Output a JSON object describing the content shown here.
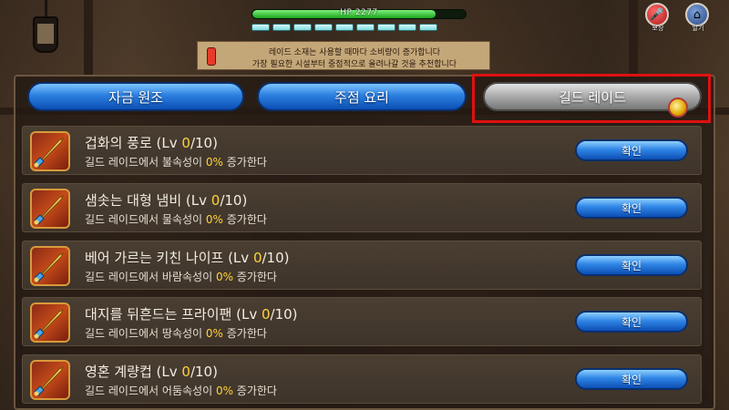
{
  "hud": {
    "hp_text": "HP 2277",
    "hp_fraction": 0.86,
    "energy_pips": 9,
    "icons": [
      {
        "name": "event-icon",
        "label": "보상"
      },
      {
        "name": "home-icon",
        "label": "알기"
      }
    ]
  },
  "notice": {
    "line1": "레이드 소재는 사용할 때마다 소비량이 증가합니다",
    "line2": "가장 필요한 시설부터 중점적으로 올려나갈 것을 추천합니다"
  },
  "tabs": [
    {
      "label": "자금 원조",
      "style": "blue"
    },
    {
      "label": "주점 요리",
      "style": "blue"
    },
    {
      "label": "길드 레이드",
      "style": "gray",
      "selected": true
    }
  ],
  "rows": [
    {
      "name": "겁화의 풍로",
      "lv_prefix": " (Lv ",
      "lv_cur": "0",
      "lv_max": "/10)",
      "desc_pre": "길드 레이드에서 불속성이 ",
      "pct": "0%",
      "desc_post": " 증가한다",
      "button": "확인"
    },
    {
      "name": "샘솟는 대형 냄비",
      "lv_prefix": " (Lv ",
      "lv_cur": "0",
      "lv_max": "/10)",
      "desc_pre": "길드 레이드에서 물속성이 ",
      "pct": "0%",
      "desc_post": " 증가한다",
      "button": "확인"
    },
    {
      "name": "베어 가르는 키친 나이프",
      "lv_prefix": " (Lv ",
      "lv_cur": "0",
      "lv_max": "/10)",
      "desc_pre": "길드 레이드에서 바람속성이 ",
      "pct": "0%",
      "desc_post": " 증가한다",
      "button": "확인"
    },
    {
      "name": "대지를 뒤흔드는 프라이팬",
      "lv_prefix": " (Lv ",
      "lv_cur": "0",
      "lv_max": "/10)",
      "desc_pre": "길드 레이드에서 땅속성이 ",
      "pct": "0%",
      "desc_post": " 증가한다",
      "button": "확인"
    },
    {
      "name": "영혼 계량컵",
      "lv_prefix": " (Lv ",
      "lv_cur": "0",
      "lv_max": "/10)",
      "desc_pre": "길드 레이드에서 어둠속성이 ",
      "pct": "0%",
      "desc_post": " 증가한다",
      "button": "확인"
    }
  ],
  "colors": {
    "accent_blue": "#2b7fe0",
    "highlight_red": "#e01010",
    "value_yellow": "#ffd33a"
  }
}
